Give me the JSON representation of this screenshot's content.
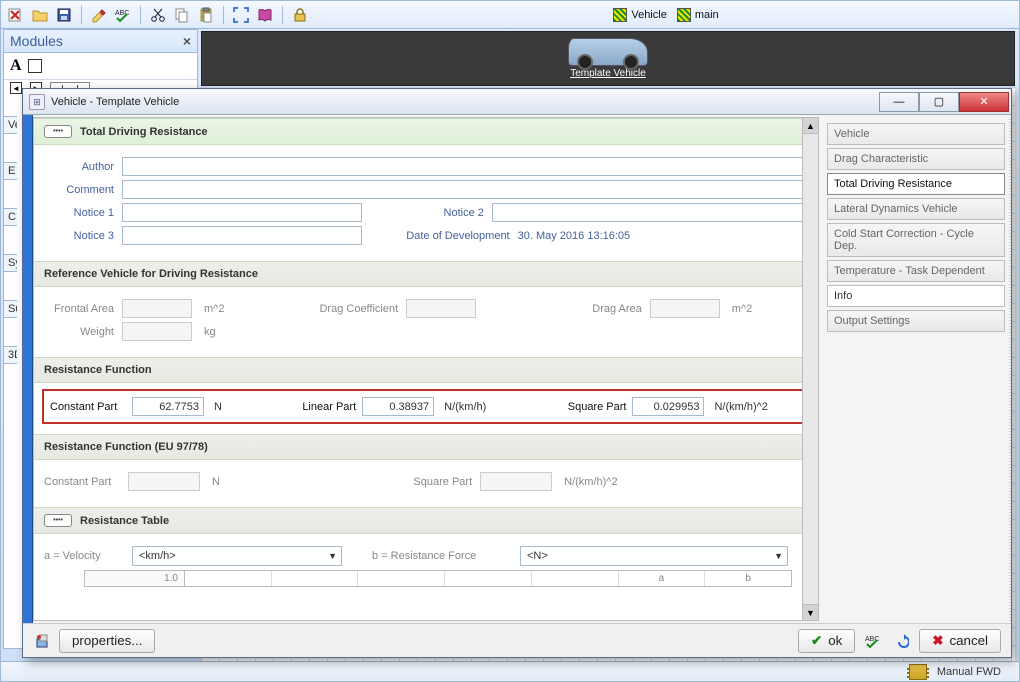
{
  "toolbar": {
    "vehicle_tab": "Vehicle",
    "main_tab": "main"
  },
  "modules": {
    "title": "Modules"
  },
  "stage": {
    "label": "Template Vehicle"
  },
  "left_tabs": [
    "Ve",
    "E",
    "C",
    "Sy",
    "Su",
    "3D"
  ],
  "dialog": {
    "title": "Vehicle - Template Vehicle",
    "nav": {
      "vehicle": "Vehicle",
      "drag": "Drag Characteristic",
      "tdr": "Total Driving Resistance",
      "lateral": "Lateral Dynamics Vehicle",
      "cold": "Cold Start Correction - Cycle Dep.",
      "temp": "Temperature - Task Dependent",
      "info": "Info",
      "output": "Output Settings"
    },
    "sections": {
      "tdr": "Total Driving Resistance",
      "refveh": "Reference Vehicle for Driving Resistance",
      "resfun": "Resistance Function",
      "resfun_eu": "Resistance Function (EU 97/78)",
      "restable": "Resistance Table"
    },
    "labels": {
      "author": "Author",
      "comment": "Comment",
      "notice1": "Notice 1",
      "notice2": "Notice 2",
      "notice3": "Notice 3",
      "date_dev": "Date of Development",
      "frontal_area": "Frontal Area",
      "drag_coeff": "Drag Coefficient",
      "drag_area": "Drag Area",
      "weight": "Weight",
      "constant_part": "Constant Part",
      "linear_part": "Linear Part",
      "square_part": "Square Part",
      "a_velocity": "a = Velocity",
      "b_resforce": "b  =  Resistance Force"
    },
    "values": {
      "author": "",
      "comment": "",
      "notice1": "",
      "notice2": "",
      "notice3": "",
      "date_dev": "30. May 2016 13:16:05",
      "frontal_area": "",
      "drag_coeff": "",
      "drag_area": "",
      "weight": "",
      "rf_constant": "62.7753",
      "rf_linear": "0.38937",
      "rf_square": "0.029953",
      "eu_constant": "",
      "eu_square": "",
      "velocity_unit": "<km/h>",
      "force_unit": "<N>",
      "table_rowhead": "1.0",
      "table_col_a": "a",
      "table_col_b": "b"
    },
    "units": {
      "m2": "m^2",
      "kg": "kg",
      "N": "N",
      "N_kmh": "N/(km/h)",
      "N_kmh2": "N/(km/h)^2"
    },
    "buttons": {
      "properties": "properties...",
      "ok": "ok",
      "cancel": "cancel"
    }
  },
  "status": {
    "gearbox": "Manual FWD"
  }
}
